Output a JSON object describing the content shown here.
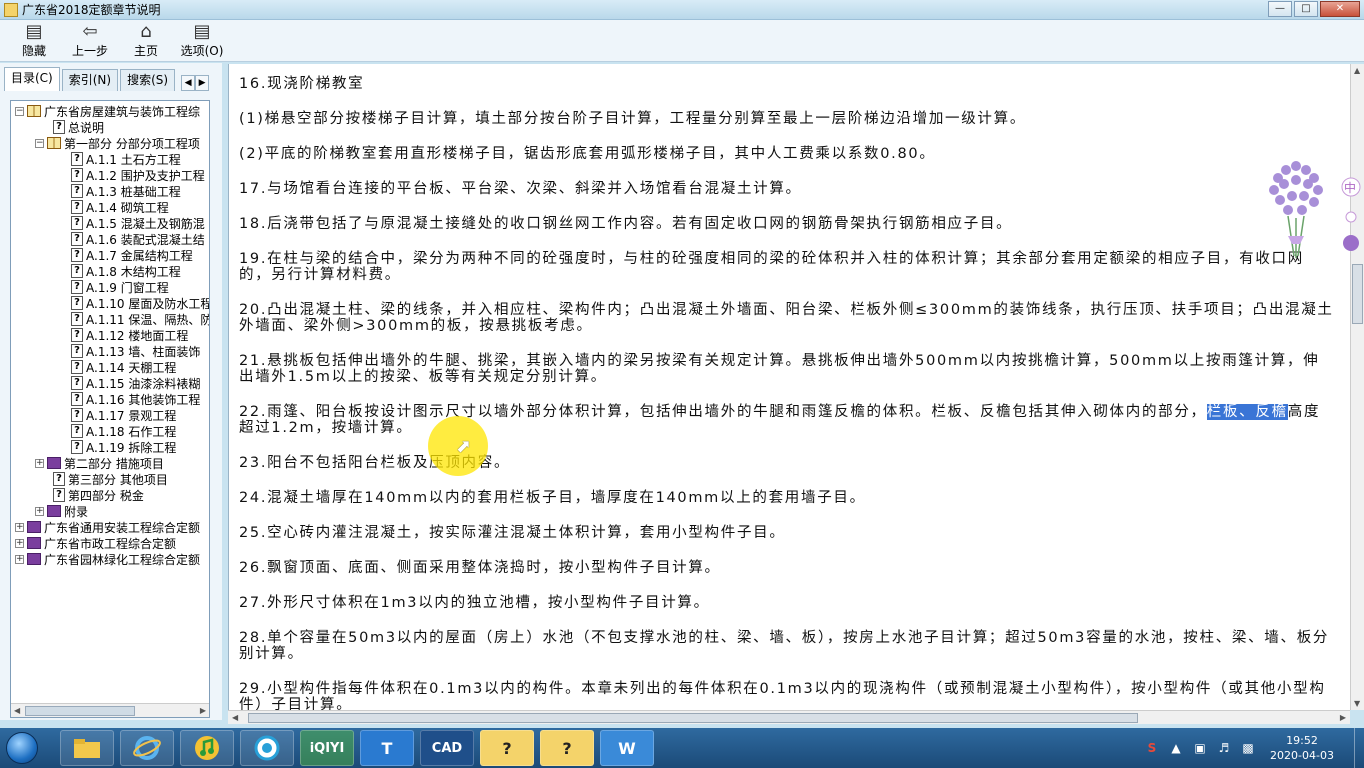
{
  "window": {
    "title": "广东省2018定额章节说明",
    "min": "0",
    "max": "1",
    "close": "r"
  },
  "toolbar": {
    "hide": "隐藏",
    "back": "上一步",
    "home": "主页",
    "options": "选项(O)"
  },
  "tabs": {
    "contents": "目录(C)",
    "index": "索引(N)",
    "search": "搜索(S)"
  },
  "tree": [
    "广东省房屋建筑与装饰工程综",
    "总说明",
    "第一部分 分部分项工程项",
    "A.1.1 土石方工程",
    "A.1.2 围护及支护工程",
    "A.1.3 桩基础工程",
    "A.1.4 砌筑工程",
    "A.1.5 混凝土及钢筋混",
    "A.1.6 装配式混凝土结",
    "A.1.7 金属结构工程",
    "A.1.8 木结构工程",
    "A.1.9 门窗工程",
    "A.1.10 屋面及防水工程",
    "A.1.11 保温、隔热、防",
    "A.1.12 楼地面工程",
    "A.1.13 墙、柱面装饰",
    "A.1.14 天棚工程",
    "A.1.15 油漆涂料裱糊",
    "A.1.16 其他装饰工程",
    "A.1.17 景观工程",
    "A.1.18 石作工程",
    "A.1.19 拆除工程",
    "第二部分 措施项目",
    "第三部分 其他项目",
    "第四部分 税金",
    "附录",
    "广东省通用安装工程综合定额",
    "广东省市政工程综合定额",
    "广东省园林绿化工程综合定额"
  ],
  "content": {
    "p16": "16.现浇阶梯教室",
    "p16a": "(1)梯悬空部分按楼梯子目计算，填土部分按台阶子目计算，工程量分别算至最上一层阶梯边沿增加一级计算。",
    "p16b": "(2)平底的阶梯教室套用直形楼梯子目，锯齿形底套用弧形楼梯子目，其中人工费乘以系数0.80。",
    "p17": "17.与场馆看台连接的平台板、平台梁、次梁、斜梁并入场馆看台混凝土计算。",
    "p18": "18.后浇带包括了与原混凝土接缝处的收口钢丝网工作内容。若有固定收口网的钢筋骨架执行钢筋相应子目。",
    "p19": "19.在柱与梁的结合中，梁分为两种不同的砼强度时，与柱的砼强度相同的梁的砼体积并入柱的体积计算；其余部分套用定额梁的相应子目，有收口网的，另行计算材料费。",
    "p20": "20.凸出混凝土柱、梁的线条，并入相应柱、梁构件内；凸出混凝土外墙面、阳台梁、栏板外侧≤300mm的装饰线条，执行压顶、扶手项目；凸出混凝土外墙面、梁外侧>300mm的板，按悬挑板考虑。",
    "p21": "21.悬挑板包括伸出墙外的牛腿、挑梁，其嵌入墙内的梁另按梁有关规定计算。悬挑板伸出墙外500mm以内按挑檐计算，500mm以上按雨篷计算，伸出墙外1.5m以上的按梁、板等有关规定分别计算。",
    "p22_pre": "22.雨篷、阳台板按设计图示尺寸以墙外部分体积计算，包括伸出墙外的牛腿和雨篷反檐的体积。栏板、反檐包括其伸入砌体内的部分，",
    "p22_hl": "栏板、反檐",
    "p22_post": "高度超过1.2m，按墙计算。",
    "p23": "23.阳台不包括阳台栏板及压顶内容。",
    "p24": "24.混凝土墙厚在140mm以内的套用栏板子目，墙厚度在140mm以上的套用墙子目。",
    "p25": "25.空心砖内灌注混凝土，按实际灌注混凝土体积计算，套用小型构件子目。",
    "p26": "26.飘窗顶面、底面、侧面采用整体浇捣时，按小型构件子目计算。",
    "p27": "27.外形尺寸体积在1m3以内的独立池槽，按小型构件子目计算。",
    "p28": "28.单个容量在50m3以内的屋面（房上）水池（不包支撑水池的柱、梁、墙、板），按房上水池子目计算；超过50m3容量的水池，按柱、梁、墙、板分别计算。",
    "p29": "29.小型构件指每件体积在0.1m3以内的构件。本章未列出的每件体积在0.1m3以内的现浇构件（或预制混凝土小型构件），按小型构件（或其他小型构件）子目计算。"
  },
  "side_widget": {
    "label": "中"
  },
  "taskbar": {
    "time": "19:52",
    "date": "2020-04-03",
    "apps": [
      "explorer-icon",
      "ie-icon",
      "music-icon",
      "chat-icon",
      "iqiyi-icon",
      "t-icon",
      "cad-icon",
      "help-icon",
      "help-icon",
      "wps-icon"
    ],
    "iqiyi": "iQIYI",
    "t": "T",
    "cad": "CAD",
    "help1": "?",
    "help2": "?",
    "wps": "W"
  },
  "colors": {
    "selection": "#3a75d6",
    "cursor_halo": "#ffe600",
    "taskbar": "#1b4a78"
  }
}
